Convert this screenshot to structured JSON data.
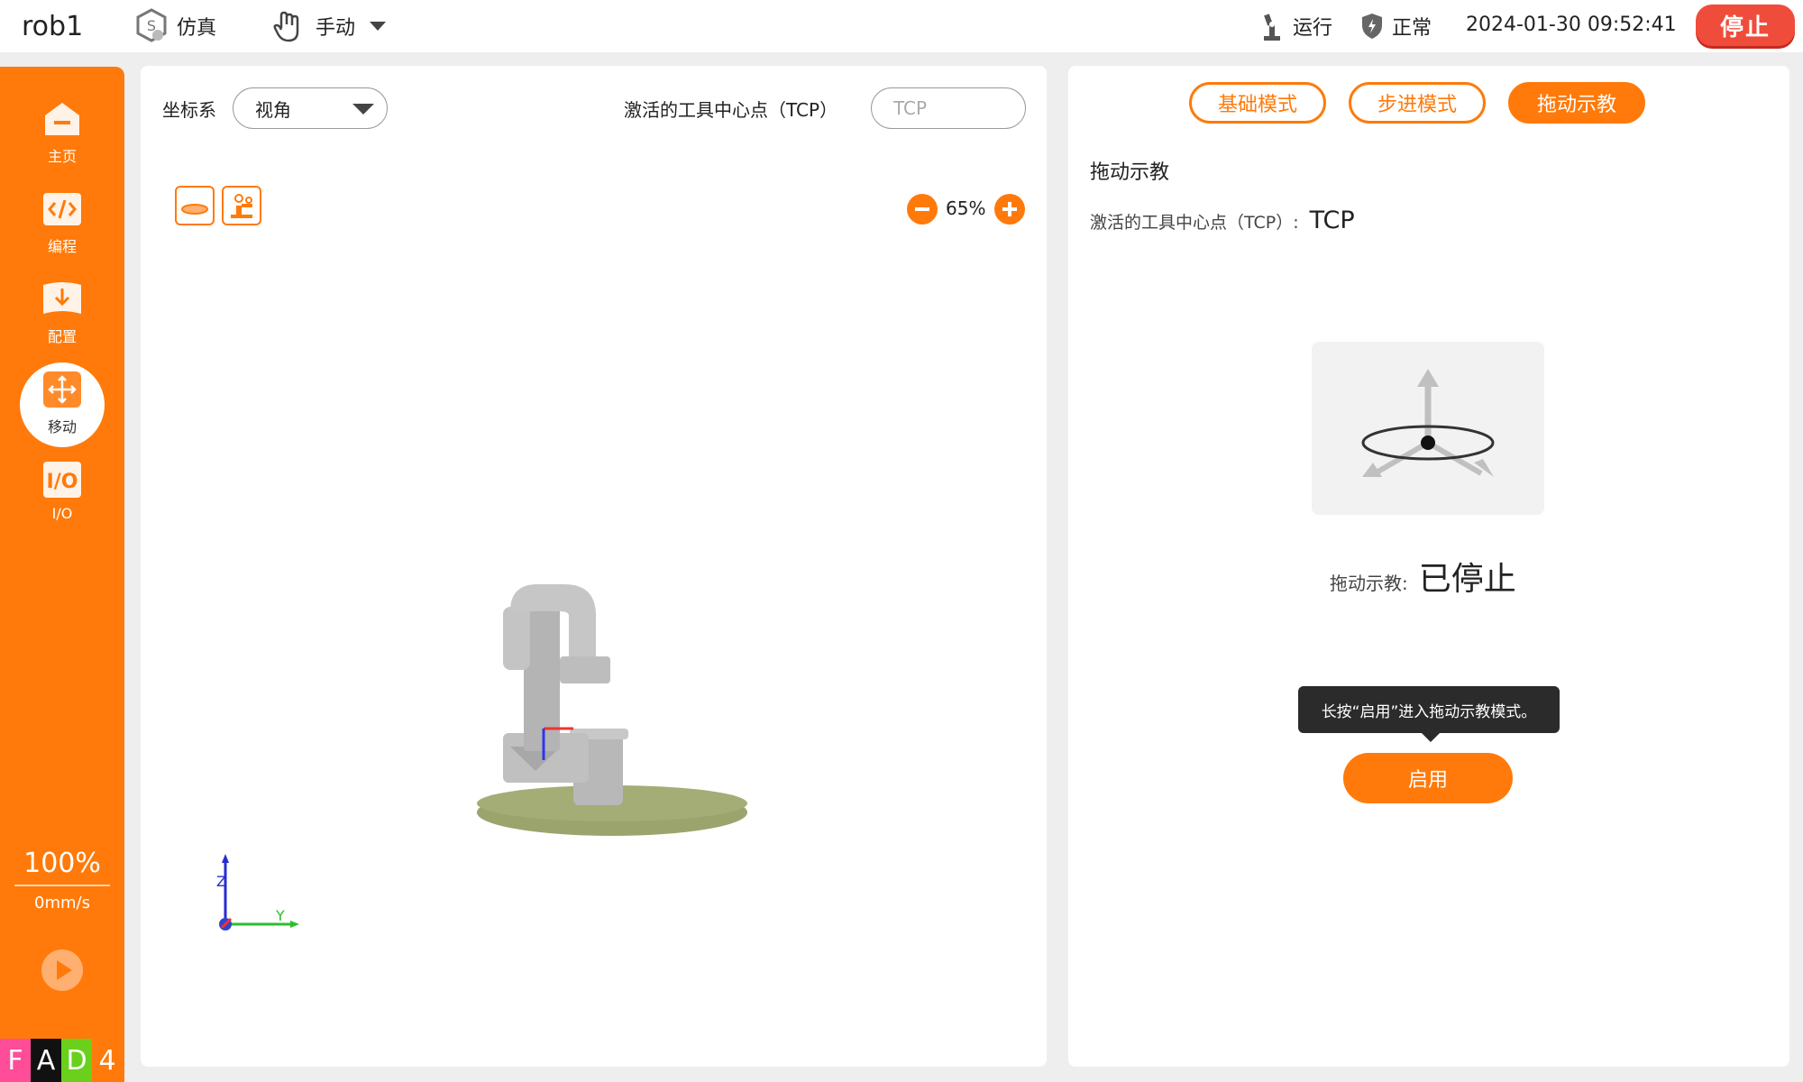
{
  "header": {
    "robot_name": "rob1",
    "sim_label": "仿真",
    "mode_label": "手动",
    "run_status": "运行",
    "safety_status": "正常",
    "datetime": "2024-01-30 09:52:41",
    "stop_label": "停止"
  },
  "sidebar": {
    "items": [
      {
        "label": "主页",
        "icon": "home-icon"
      },
      {
        "label": "编程",
        "icon": "code-icon"
      },
      {
        "label": "配置",
        "icon": "config-download-icon"
      },
      {
        "label": "移动",
        "icon": "move-icon",
        "active": true
      },
      {
        "label": "I/O",
        "icon": "io-icon"
      }
    ],
    "speed_percent": "100%",
    "speed_value": "0mm/s",
    "indicators": [
      {
        "char": "F",
        "color": "#ff4d9a"
      },
      {
        "char": "A",
        "color": "#111111"
      },
      {
        "char": "D",
        "color": "#6ad01c"
      },
      {
        "char": "4",
        "color": "#ff7a0a"
      }
    ]
  },
  "view_panel": {
    "coord_label": "坐标系",
    "coord_value": "视角",
    "tcp_label": "激活的工具中心点（TCP）",
    "tcp_placeholder": "TCP",
    "zoom_value": "65%",
    "axis_labels": {
      "z": "Z",
      "y": "Y"
    }
  },
  "teach_panel": {
    "tabs": [
      {
        "label": "基础模式",
        "active": false
      },
      {
        "label": "步进模式",
        "active": false
      },
      {
        "label": "拖动示教",
        "active": true
      }
    ],
    "section_title": "拖动示教",
    "tcp_label": "激活的工具中心点（TCP）:",
    "tcp_value": "TCP",
    "status_label": "拖动示教:",
    "status_value": "已停止",
    "tooltip": "长按“启用”进入拖动示教模式。",
    "enable_label": "启用"
  },
  "colors": {
    "accent": "#ff7a0a",
    "stop": "#f04c3c"
  }
}
